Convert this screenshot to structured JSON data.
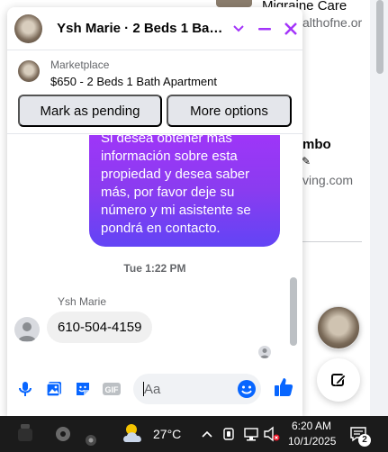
{
  "background_page": {
    "items": [
      {
        "title": "Migraine Care",
        "url": "althofne.or"
      },
      {
        "title": "mbo",
        "url": "ving.com"
      }
    ]
  },
  "chat": {
    "title": "Ysh Marie · 2 Beds 1 Bath ...",
    "accent_color": "#a334fa",
    "marketplace": {
      "label": "Marketplace",
      "listing": "$650 - 2 Beds 1 Bath Apartment",
      "mark_pending_label": "Mark as pending",
      "more_options_label": "More options"
    },
    "messages": {
      "outgoing_text": "Si desea obtener más información sobre esta propiedad y desea saber más, por favor deje su número y mi asistente se pondrá en contacto.",
      "timestamp": "Tue 1:22 PM",
      "sender_name": "Ysh Marie",
      "incoming_text": "610-504-4159"
    },
    "composer": {
      "placeholder": "Aa",
      "icons": [
        "microphone-icon",
        "photo-icon",
        "sticker-icon",
        "gif-icon",
        "emoji-icon",
        "thumbs-up-icon"
      ]
    }
  },
  "taskbar": {
    "temperature": "27°C",
    "time": "6:20 AM",
    "date": "10/1/2025",
    "notification_count": "2"
  }
}
